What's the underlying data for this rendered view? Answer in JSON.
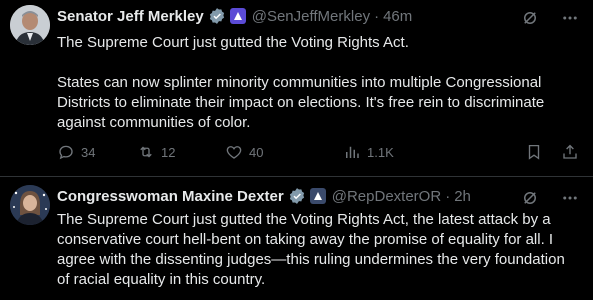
{
  "tweets": [
    {
      "name": "Senator Jeff Merkley",
      "handle": "@SenJeffMerkley",
      "separator": "·",
      "time": "46m",
      "paragraphs": [
        "The Supreme Court just gutted the Voting Rights Act.",
        "States can now splinter minority communities into multiple Congressional Districts to eliminate their impact on elections. It's free rein to discriminate against communities of color."
      ],
      "stats": {
        "replies": "34",
        "reposts": "12",
        "likes": "40",
        "views": "1.1K"
      }
    },
    {
      "name": "Congresswoman Maxine Dexter",
      "handle": "@RepDexterOR",
      "separator": "·",
      "time": "2h",
      "paragraphs": [
        "The Supreme Court just gutted the Voting Rights Act, the latest attack by a conservative court hell-bent on taking away the promise of equality for all. I agree with the dissenting judges—this ruling undermines the very foundation of racial equality in this country."
      ]
    }
  ],
  "colors": {
    "background": "#000000",
    "text": "#e7e9ea",
    "muted": "#71767b",
    "verified": "#829aab",
    "divider": "#2f3336"
  },
  "icons": [
    "verified-badge-icon",
    "government-affiliation-icon",
    "grok-icon",
    "more-icon",
    "reply-icon",
    "repost-icon",
    "like-icon",
    "views-icon",
    "bookmark-icon",
    "share-icon"
  ]
}
